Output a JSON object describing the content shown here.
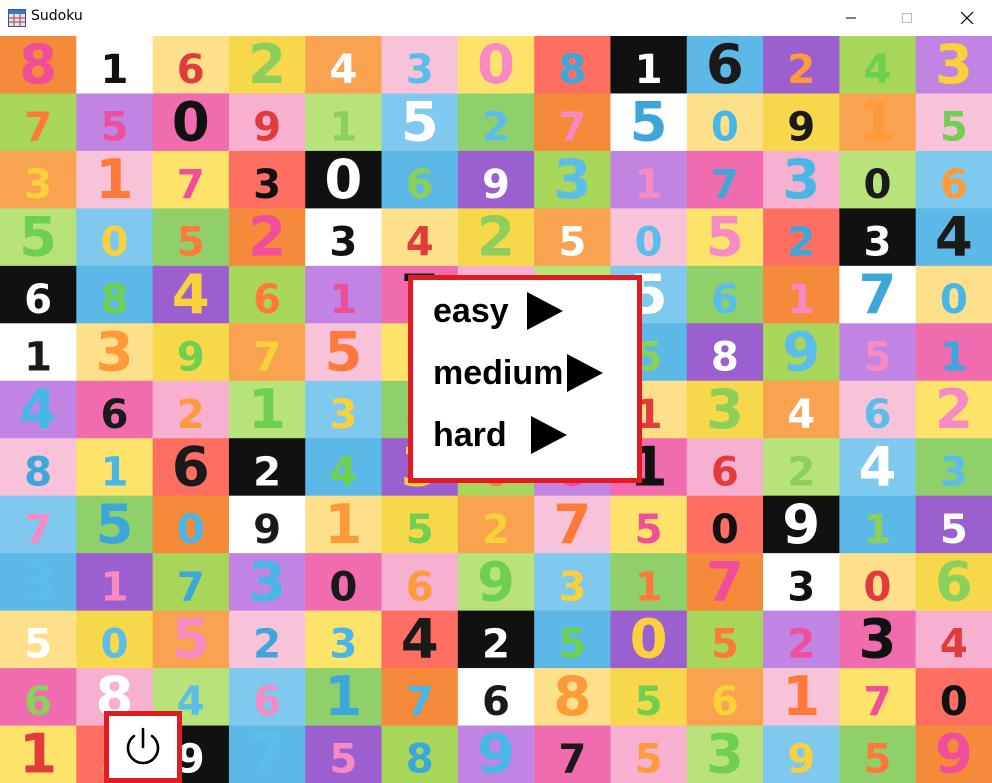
{
  "window": {
    "title": "Sudoku",
    "icon": "grid-app-icon",
    "controls": [
      "minimize-icon",
      "maximize-icon",
      "close-icon"
    ]
  },
  "difficulty_menu": {
    "items": [
      {
        "label": "easy",
        "icon": "play-arrow-icon"
      },
      {
        "label": "medium",
        "icon": "play-arrow-icon"
      },
      {
        "label": "hard",
        "icon": "play-arrow-icon"
      }
    ],
    "border_color": "#e01b22"
  },
  "power_button": {
    "icon": "power-icon",
    "border_color": "#e01b22"
  },
  "background": {
    "description_icon": "colorful-numbers-background",
    "tiles": [
      {
        "n": "8"
      },
      {
        "n": "1"
      },
      {
        "n": "6"
      },
      {
        "n": "2"
      },
      {
        "n": "4"
      },
      {
        "n": "3"
      },
      {
        "n": "0"
      },
      {
        "n": "8"
      },
      {
        "n": "1"
      },
      {
        "n": "6"
      },
      {
        "n": "2"
      },
      {
        "n": "4"
      },
      {
        "n": "3"
      },
      {
        "n": "7"
      },
      {
        "n": "5"
      },
      {
        "n": "0"
      },
      {
        "n": "9"
      },
      {
        "n": "1"
      },
      {
        "n": "5"
      },
      {
        "n": "2"
      },
      {
        "n": "7"
      },
      {
        "n": "5"
      },
      {
        "n": "0"
      },
      {
        "n": "9"
      },
      {
        "n": "1"
      },
      {
        "n": "5"
      },
      {
        "n": "3"
      },
      {
        "n": "1"
      },
      {
        "n": "7"
      },
      {
        "n": "3"
      },
      {
        "n": "0"
      },
      {
        "n": "6"
      },
      {
        "n": "9"
      },
      {
        "n": "3"
      },
      {
        "n": "1"
      },
      {
        "n": "7"
      },
      {
        "n": "3"
      },
      {
        "n": "0"
      },
      {
        "n": "6"
      },
      {
        "n": "5"
      },
      {
        "n": "0"
      },
      {
        "n": "5"
      },
      {
        "n": "2"
      },
      {
        "n": "3"
      },
      {
        "n": "4"
      },
      {
        "n": "2"
      },
      {
        "n": "5"
      },
      {
        "n": "0"
      },
      {
        "n": "5"
      },
      {
        "n": "2"
      },
      {
        "n": "3"
      },
      {
        "n": "4"
      },
      {
        "n": "6"
      },
      {
        "n": "8"
      },
      {
        "n": "4"
      },
      {
        "n": "6"
      },
      {
        "n": "1"
      },
      {
        "n": "7"
      },
      {
        "n": "6"
      },
      {
        "n": "8"
      },
      {
        "n": "5"
      },
      {
        "n": "6"
      },
      {
        "n": "1"
      },
      {
        "n": "7"
      },
      {
        "n": "0"
      },
      {
        "n": "1"
      },
      {
        "n": "3"
      },
      {
        "n": "9"
      },
      {
        "n": "7"
      },
      {
        "n": "5"
      },
      {
        "n": "8"
      },
      {
        "n": "9"
      },
      {
        "n": "7"
      },
      {
        "n": "5"
      },
      {
        "n": "8"
      },
      {
        "n": "9"
      },
      {
        "n": "5"
      },
      {
        "n": "1"
      },
      {
        "n": "4"
      },
      {
        "n": "6"
      },
      {
        "n": "2"
      },
      {
        "n": "1"
      },
      {
        "n": "3"
      },
      {
        "n": "4"
      },
      {
        "n": "6"
      },
      {
        "n": "2"
      },
      {
        "n": "1"
      },
      {
        "n": "3"
      },
      {
        "n": "4"
      },
      {
        "n": "6"
      },
      {
        "n": "2"
      },
      {
        "n": "8"
      },
      {
        "n": "1"
      },
      {
        "n": "6"
      },
      {
        "n": "2"
      },
      {
        "n": "4"
      },
      {
        "n": "3"
      },
      {
        "n": "0"
      },
      {
        "n": "8"
      },
      {
        "n": "1"
      },
      {
        "n": "6"
      },
      {
        "n": "2"
      },
      {
        "n": "4"
      },
      {
        "n": "3"
      },
      {
        "n": "7"
      },
      {
        "n": "5"
      },
      {
        "n": "0"
      },
      {
        "n": "9"
      },
      {
        "n": "1"
      },
      {
        "n": "5"
      },
      {
        "n": "2"
      },
      {
        "n": "7"
      },
      {
        "n": "5"
      },
      {
        "n": "0"
      },
      {
        "n": "9"
      },
      {
        "n": "1"
      },
      {
        "n": "5"
      },
      {
        "n": "3"
      },
      {
        "n": "1"
      },
      {
        "n": "7"
      },
      {
        "n": "3"
      },
      {
        "n": "0"
      },
      {
        "n": "6"
      },
      {
        "n": "9"
      },
      {
        "n": "3"
      },
      {
        "n": "1"
      },
      {
        "n": "7"
      },
      {
        "n": "3"
      },
      {
        "n": "0"
      },
      {
        "n": "6"
      },
      {
        "n": "5"
      },
      {
        "n": "0"
      },
      {
        "n": "5"
      },
      {
        "n": "2"
      },
      {
        "n": "3"
      },
      {
        "n": "4"
      },
      {
        "n": "2"
      },
      {
        "n": "5"
      },
      {
        "n": "0"
      },
      {
        "n": "5"
      },
      {
        "n": "2"
      },
      {
        "n": "3"
      },
      {
        "n": "4"
      },
      {
        "n": "6"
      },
      {
        "n": "8"
      },
      {
        "n": "4"
      },
      {
        "n": "6"
      },
      {
        "n": "1"
      },
      {
        "n": "7"
      },
      {
        "n": "6"
      },
      {
        "n": "8"
      },
      {
        "n": "5"
      },
      {
        "n": "6"
      },
      {
        "n": "1"
      },
      {
        "n": "7"
      },
      {
        "n": "0"
      },
      {
        "n": "1"
      },
      {
        "n": "3"
      },
      {
        "n": "9"
      },
      {
        "n": "7"
      },
      {
        "n": "5"
      },
      {
        "n": "8"
      },
      {
        "n": "9"
      },
      {
        "n": "7"
      },
      {
        "n": "5"
      },
      {
        "n": "3"
      },
      {
        "n": "9"
      },
      {
        "n": "5"
      },
      {
        "n": "9"
      }
    ]
  }
}
